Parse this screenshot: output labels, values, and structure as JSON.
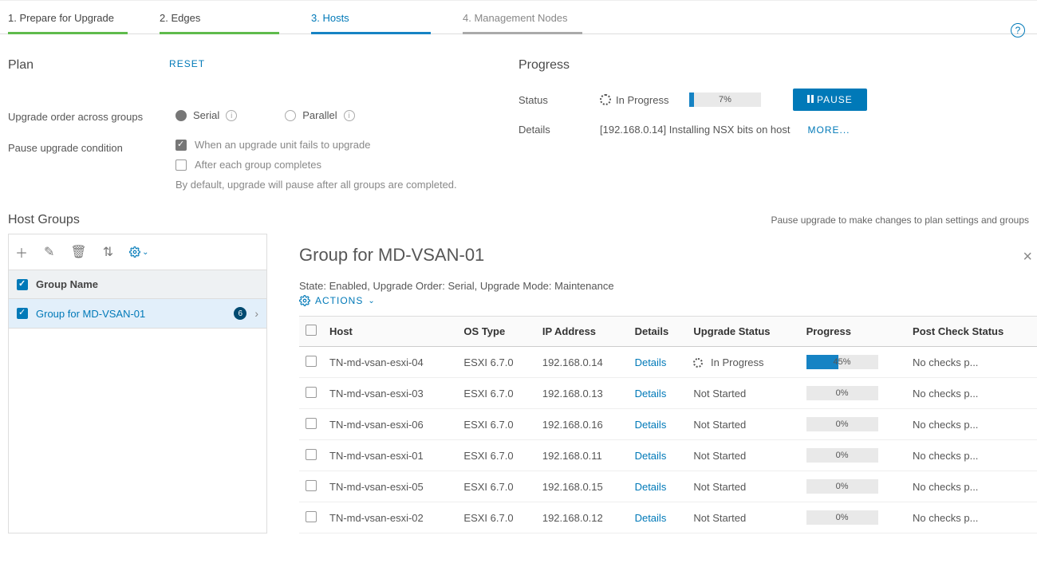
{
  "tabs": [
    {
      "label": "1. Prepare for Upgrade",
      "state": "done"
    },
    {
      "label": "2. Edges",
      "state": "done"
    },
    {
      "label": "3. Hosts",
      "state": "active"
    },
    {
      "label": "4. Management Nodes",
      "state": "pending"
    }
  ],
  "plan": {
    "title": "Plan",
    "reset_label": "RESET",
    "order_label": "Upgrade order across groups",
    "serial_label": "Serial",
    "parallel_label": "Parallel",
    "pause_label": "Pause upgrade condition",
    "cond_fail": "When an upgrade unit fails to upgrade",
    "cond_group": "After each group completes",
    "helper": "By default, upgrade will pause after all groups are completed."
  },
  "progress": {
    "title": "Progress",
    "status_label": "Status",
    "status_text": "In Progress",
    "percent_text": "7%",
    "percent_width": "7%",
    "pause_btn": "PAUSE",
    "details_label": "Details",
    "details_text": "[192.168.0.14] Installing NSX bits on host",
    "more_label": "MORE..."
  },
  "host_groups": {
    "title": "Host Groups",
    "hint": "Pause upgrade to make changes to plan settings and groups",
    "header_label": "Group Name",
    "group_name": "Group for MD-VSAN-01",
    "group_count": "6"
  },
  "detail": {
    "title": "Group for MD-VSAN-01",
    "state_line": "State: Enabled, Upgrade Order: Serial, Upgrade Mode: Maintenance",
    "actions_label": "ACTIONS",
    "columns": {
      "host": "Host",
      "os": "OS Type",
      "ip": "IP Address",
      "details": "Details",
      "status": "Upgrade Status",
      "progress": "Progress",
      "post": "Post Check Status"
    },
    "rows": [
      {
        "host": "TN-md-vsan-esxi-04",
        "os": "ESXI 6.7.0",
        "ip": "192.168.0.14",
        "details": "Details",
        "status": "In Progress",
        "in_progress": true,
        "progress_text": "45%",
        "progress_width": "45%",
        "post": "No checks p..."
      },
      {
        "host": "TN-md-vsan-esxi-03",
        "os": "ESXI 6.7.0",
        "ip": "192.168.0.13",
        "details": "Details",
        "status": "Not Started",
        "in_progress": false,
        "progress_text": "0%",
        "progress_width": "0%",
        "post": "No checks p..."
      },
      {
        "host": "TN-md-vsan-esxi-06",
        "os": "ESXI 6.7.0",
        "ip": "192.168.0.16",
        "details": "Details",
        "status": "Not Started",
        "in_progress": false,
        "progress_text": "0%",
        "progress_width": "0%",
        "post": "No checks p..."
      },
      {
        "host": "TN-md-vsan-esxi-01",
        "os": "ESXI 6.7.0",
        "ip": "192.168.0.11",
        "details": "Details",
        "status": "Not Started",
        "in_progress": false,
        "progress_text": "0%",
        "progress_width": "0%",
        "post": "No checks p..."
      },
      {
        "host": "TN-md-vsan-esxi-05",
        "os": "ESXI 6.7.0",
        "ip": "192.168.0.15",
        "details": "Details",
        "status": "Not Started",
        "in_progress": false,
        "progress_text": "0%",
        "progress_width": "0%",
        "post": "No checks p..."
      },
      {
        "host": "TN-md-vsan-esxi-02",
        "os": "ESXI 6.7.0",
        "ip": "192.168.0.12",
        "details": "Details",
        "status": "Not Started",
        "in_progress": false,
        "progress_text": "0%",
        "progress_width": "0%",
        "post": "No checks p..."
      }
    ]
  }
}
